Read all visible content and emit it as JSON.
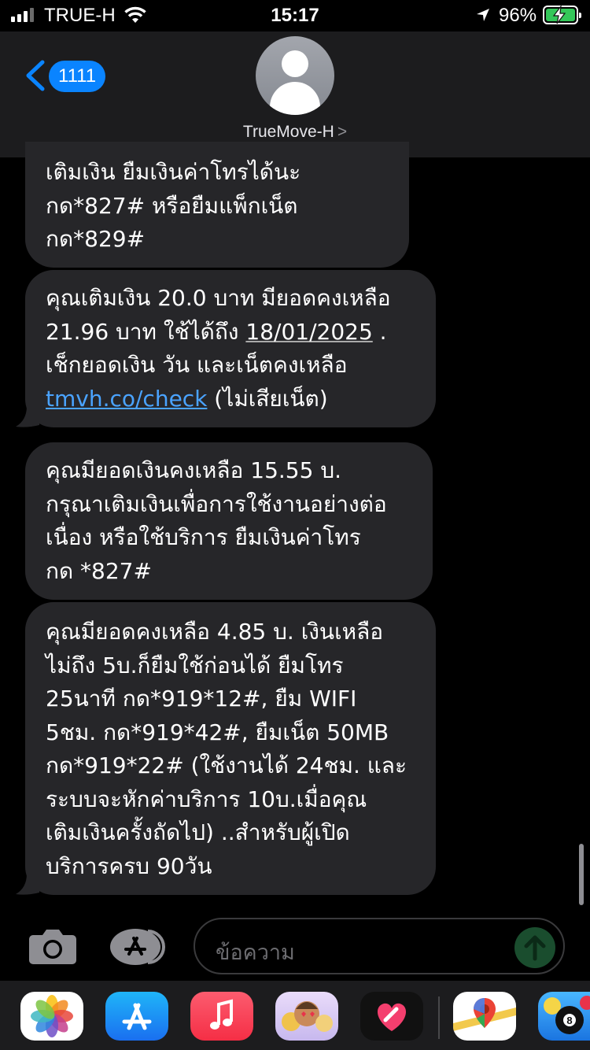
{
  "status_bar": {
    "carrier": "TRUE-H",
    "time": "15:17",
    "battery_percent": "96%",
    "signal_bars": 3
  },
  "header": {
    "back_badge": "1111",
    "contact_name": "TrueMove-H",
    "contact_chevron": ">"
  },
  "messages": [
    {
      "lines": [
        "เติมเงิน ยืมเงินค่าโทรได้นะ",
        "กด*827# หรือยืมแพ็กเน็ต",
        "กด*829#"
      ]
    },
    {
      "line1": "คุณเติมเงิน 20.0 บาท มียอดคงเหลือ",
      "line2_pre": "21.96 บาท ใช้ได้ถึง ",
      "line2_date": "18/01/2025",
      "line2_post": " .",
      "line3": "เช็กยอดเงิน วัน และเน็ตคงเหลือ",
      "line4_link": "tmvh.co/check",
      "line4_post": " (ไม่เสียเน็ต)"
    },
    {
      "lines": [
        "คุณมียอดเงินคงเหลือ 15.55 บ.",
        "กรุณาเติมเงินเพื่อการใช้งานอย่างต่อ",
        "เนื่อง หรือใช้บริการ ยืมเงินค่าโทร",
        "กด *827#"
      ]
    },
    {
      "lines": [
        "คุณมียอดคงเหลือ 4.85 บ. เงินเหลือ",
        "ไม่ถึง 5บ.ก็ยืมใช้ก่อนได้ ยืมโทร",
        "25นาที กด*919*12#, ยืม WIFI",
        "5ชม. กด*919*42#, ยืมเน็ต 50MB",
        "กด*919*22# (ใช้งานได้ 24ชม. และ",
        "ระบบจะหักค่าบริการ 10บ.เมื่อคุณ",
        "เติมเงินครั้งถัดไป) ..สำหรับผู้เปิด",
        "บริการครบ 90วัน"
      ]
    }
  ],
  "composer": {
    "placeholder": "ข้อความ"
  },
  "dock": {
    "apps": [
      "photos-app",
      "app-store-app",
      "music-app",
      "memoji-app",
      "fitness-heart-app",
      "maps-app",
      "pool-game-app"
    ]
  },
  "colors": {
    "bubble": "#262629",
    "link": "#4aa3ff",
    "badge": "#0a84ff",
    "battery": "#34c759"
  }
}
